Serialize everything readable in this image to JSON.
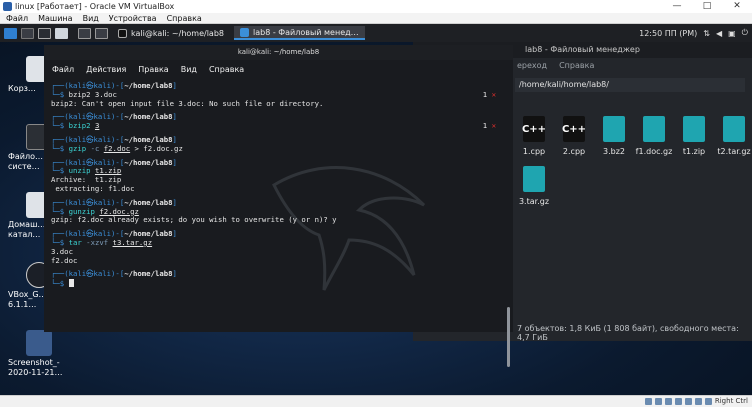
{
  "vbox": {
    "title": "linux [Работает] - Oracle VM VirtualBox",
    "menu": [
      "Файл",
      "Машина",
      "Вид",
      "Устройства",
      "Справка"
    ],
    "controls": [
      "—",
      "□",
      "✕"
    ],
    "host_key": "Right Ctrl"
  },
  "panel": {
    "tasks": [
      {
        "label": "kali@kali: ~/home/lab8",
        "active": false
      },
      {
        "label": "lab8 - Файловый менед…",
        "active": true
      }
    ],
    "clock": "12:50 ПП (PM)",
    "day": "5"
  },
  "desktop_icons": [
    {
      "label": "Корз…",
      "color": "#dfe3e8"
    },
    {
      "label": "Файло… систе…",
      "color": "#2b2f35"
    },
    {
      "label": "Домаш… катал…",
      "color": "#dfe3e8"
    },
    {
      "label": "VBox_G… 6.1.1…",
      "color": "#1b1f27"
    },
    {
      "label": "Screenshot_-\n2020-11-21…",
      "color": "#3a5b8c"
    }
  ],
  "file_manager": {
    "title": "lab8 - Файловый менеджер",
    "menu": [
      "ереход",
      "Справка"
    ],
    "path": "/home/kali/home/lab8/",
    "files": [
      {
        "name": "1.cpp",
        "type": "cpp"
      },
      {
        "name": "2.cpp",
        "type": "cpp"
      },
      {
        "name": "3.bz2",
        "type": "arch"
      },
      {
        "name": "f1.doc.gz",
        "type": "arch"
      },
      {
        "name": "t1.zip",
        "type": "arch"
      },
      {
        "name": "t2.tar.gz",
        "type": "arch"
      },
      {
        "name": "3.tar.gz",
        "type": "arch"
      }
    ],
    "status": "7 объектов: 1,8 КиБ (1 808 байт), свободного места: 4,7 ГиБ"
  },
  "terminal": {
    "title": "kali@kali: ~/home/lab8",
    "menu": [
      "Файл",
      "Действия",
      "Правка",
      "Вид",
      "Справка"
    ],
    "prompt_user": "(kali㉿kali)",
    "prompt_path": "~/home/lab8",
    "lines": {
      "c1": "bzip2 3.doc",
      "o1": "bzip2: Can't open input file 3.doc: No such file or directory.",
      "c2_cmd": "bzip2",
      "c2_arg": "3",
      "c3_cmd": "gzip",
      "c3_opt": "-c",
      "c3_arg": "f2.doc",
      "c3_rest": " > f2.doc.gz",
      "c4_cmd": "unzip",
      "c4_arg": "t1.zip",
      "o4a": "Archive:  t1.zip",
      "o4b": " extracting: f1.doc",
      "c5_cmd": "gunzip",
      "c5_arg": "f2.doc.gz",
      "o5": "gzip: f2.doc already exists; do you wish to overwrite (y or n)? y",
      "c6_cmd": "tar",
      "c6_opt": "-xzvf",
      "c6_arg": "t3.tar.gz",
      "o6a": "3.doc",
      "o6b": "f2.doc"
    },
    "exit_code": "1",
    "error_mark": "✕"
  }
}
